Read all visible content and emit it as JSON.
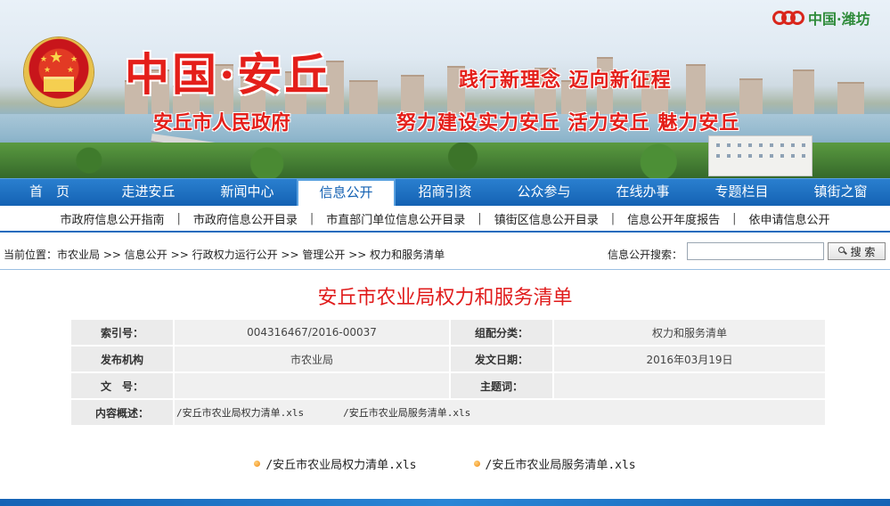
{
  "banner": {
    "site_title": "中国·安丘",
    "sub_title": "安丘市人民政府",
    "slogan_top": "践行新理念  迈向新征程",
    "slogan_bottom": "努力建设实力安丘 活力安丘 魅力安丘",
    "portal_logo_text": "中国·潍坊"
  },
  "nav": {
    "items": [
      {
        "label": "首　页"
      },
      {
        "label": "走进安丘"
      },
      {
        "label": "新闻中心"
      },
      {
        "label": "信息公开"
      },
      {
        "label": "招商引资"
      },
      {
        "label": "公众参与"
      },
      {
        "label": "在线办事"
      },
      {
        "label": "专题栏目"
      },
      {
        "label": "镇街之窗"
      }
    ],
    "active": "信息公开"
  },
  "subnav": {
    "items": [
      {
        "label": "市政府信息公开指南"
      },
      {
        "label": "市政府信息公开目录"
      },
      {
        "label": "市直部门单位信息公开目录"
      },
      {
        "label": "镇街区信息公开目录"
      },
      {
        "label": "信息公开年度报告"
      },
      {
        "label": "依申请信息公开"
      }
    ],
    "separator": "|"
  },
  "breadcrumb": {
    "prefix": "当前位置：",
    "items": [
      "市农业局",
      "信息公开",
      "行政权力运行公开",
      "管理公开",
      "权力和服务清单"
    ],
    "separator": ">>"
  },
  "search": {
    "label": "信息公开搜索：",
    "value": "",
    "button_label": "搜 索"
  },
  "article": {
    "title": "安丘市农业局权力和服务清单",
    "meta": {
      "index_no_label": "索引号：",
      "index_no": "004316467/2016-00037",
      "category_label": "组配分类：",
      "category": "权力和服务清单",
      "publisher_label": "发布机构",
      "publisher": "市农业局",
      "date_label": "发文日期：",
      "date": "2016年03月19日",
      "doc_no_label": "文　号：",
      "doc_no": "",
      "subject_label": "主题词：",
      "subject": "",
      "summary_label": "内容概述：",
      "summary_files": [
        "/安丘市农业局权力清单.xls",
        "/安丘市农业局服务清单.xls"
      ]
    },
    "attachments": [
      {
        "label": "/安丘市农业局权力清单.xls"
      },
      {
        "label": "/安丘市农业局服务清单.xls"
      }
    ]
  }
}
